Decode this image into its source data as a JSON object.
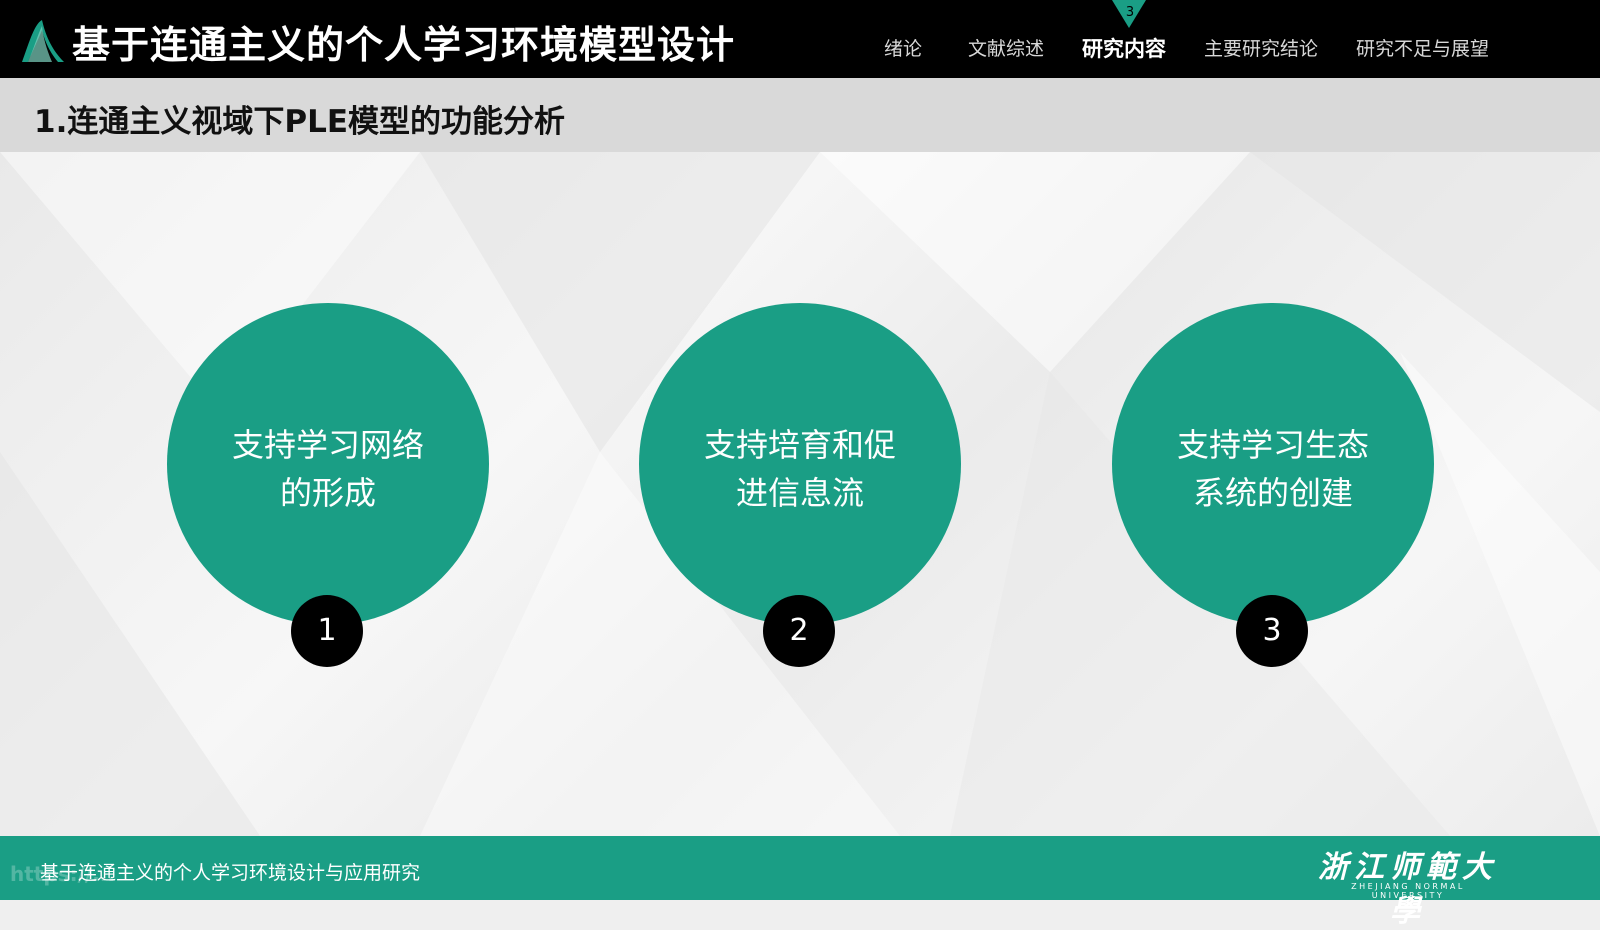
{
  "header": {
    "title": "基于连通主义的个人学习环境模型设计",
    "logo": "green-wave-logo"
  },
  "nav": {
    "items": [
      {
        "label": "绪论"
      },
      {
        "label": "文献综述"
      },
      {
        "label": "研究内容"
      },
      {
        "label": "主要研究结论"
      },
      {
        "label": "研究不足与展望"
      }
    ],
    "active_index": 2,
    "active_marker_number": "3"
  },
  "section": {
    "title": "1.连通主义视域下PLE模型的功能分析"
  },
  "cards": [
    {
      "text_line1": "支持学习网络",
      "text_line2": "的形成",
      "number": "1"
    },
    {
      "text_line1": "支持培育和促",
      "text_line2": "进信息流",
      "number": "2"
    },
    {
      "text_line1": "支持学习生态",
      "text_line2": "系统的创建",
      "number": "3"
    }
  ],
  "footer": {
    "text": "基于连通主义的个人学习环境设计与应用研究",
    "watermark": "https://..."
  },
  "university": {
    "name_cn": "浙江师範大學",
    "name_en": "ZHEJIANG NORMAL UNIVERSITY"
  },
  "colors": {
    "accent": "#1a9e85",
    "topbar": "#000000",
    "section_bar": "#d9d9d9",
    "badge": "#000000"
  }
}
